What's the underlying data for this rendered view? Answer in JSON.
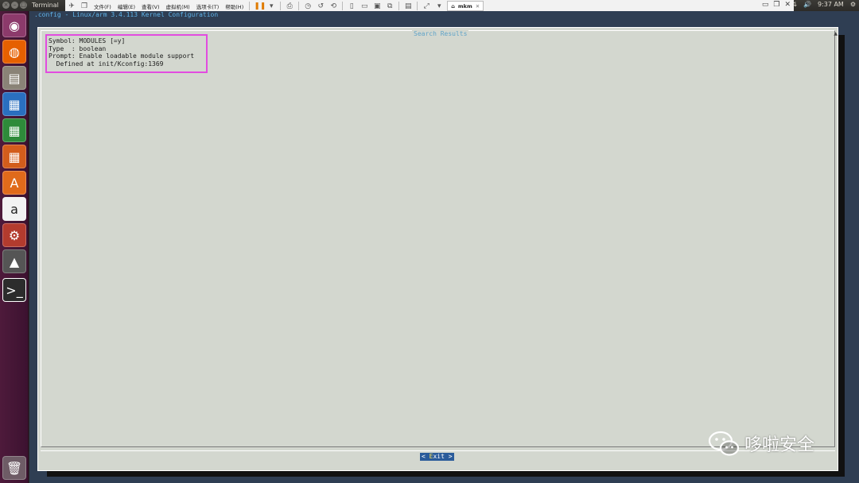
{
  "top_panel": {
    "window_title": "Terminal",
    "clock": "9:37 AM"
  },
  "vm_toolbar": {
    "menus": [
      "文件(F)",
      "编辑(E)",
      "查看(V)",
      "虚拟机(M)",
      "选项卡(T)",
      "帮助(H)"
    ],
    "tab_label": "mkm"
  },
  "terminal": {
    "menuconfig_title": ".config - Linux/arm 3.4.113 Kernel Configuration"
  },
  "dialog": {
    "title": "Search Results",
    "result_lines": [
      "Symbol: MODULES [=y]",
      "Type  : boolean",
      "Prompt: Enable loadable module support",
      "  Defined at init/Kconfig:1369"
    ],
    "exit_button": {
      "left": "< ",
      "hotkey": "E",
      "rest": "xit >"
    }
  },
  "watermark": {
    "text": "哆啦安全"
  },
  "colors": {
    "accent_highlight": "#e24ce0",
    "dialog_bg": "#d3d7cf",
    "terminal_bg": "#2f3e53",
    "button_bg": "#2a5b9a"
  }
}
